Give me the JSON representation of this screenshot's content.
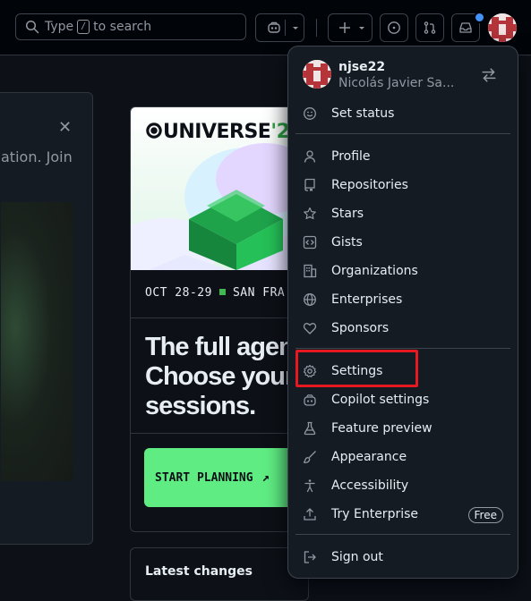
{
  "header": {
    "search_prefix": "Type",
    "search_key": "/",
    "search_suffix": "to search",
    "accent": "#4493f8"
  },
  "background": {
    "left_panel_text": "ation. Join",
    "card": {
      "brand_main": "UNIVERSE",
      "brand_suffix": "'2",
      "date": "OCT 28-29",
      "location": "SAN FRA",
      "headline_lines": [
        "The full agend",
        "Choose your f",
        "sessions."
      ],
      "cta_label": "START PLANNING",
      "cta_color": "#5fed83"
    },
    "latest_title": "Latest changes"
  },
  "menu": {
    "username": "njse22",
    "full_name": "Nicolás Javier Sa...",
    "items": [
      {
        "label": "Set status",
        "icon": "smiley-icon"
      },
      {
        "label": "Profile",
        "icon": "person-icon"
      },
      {
        "label": "Repositories",
        "icon": "repo-icon"
      },
      {
        "label": "Stars",
        "icon": "star-icon"
      },
      {
        "label": "Gists",
        "icon": "code-square-icon"
      },
      {
        "label": "Organizations",
        "icon": "organization-icon"
      },
      {
        "label": "Enterprises",
        "icon": "globe-icon"
      },
      {
        "label": "Sponsors",
        "icon": "heart-icon"
      },
      {
        "label": "Settings",
        "icon": "gear-icon"
      },
      {
        "label": "Copilot settings",
        "icon": "copilot-icon"
      },
      {
        "label": "Feature preview",
        "icon": "beaker-icon"
      },
      {
        "label": "Appearance",
        "icon": "paintbrush-icon"
      },
      {
        "label": "Accessibility",
        "icon": "accessibility-icon"
      },
      {
        "label": "Try Enterprise",
        "icon": "upload-icon",
        "badge": "Free"
      },
      {
        "label": "Sign out",
        "icon": "sign-out-icon"
      }
    ],
    "highlight_color": "#e5191f"
  }
}
